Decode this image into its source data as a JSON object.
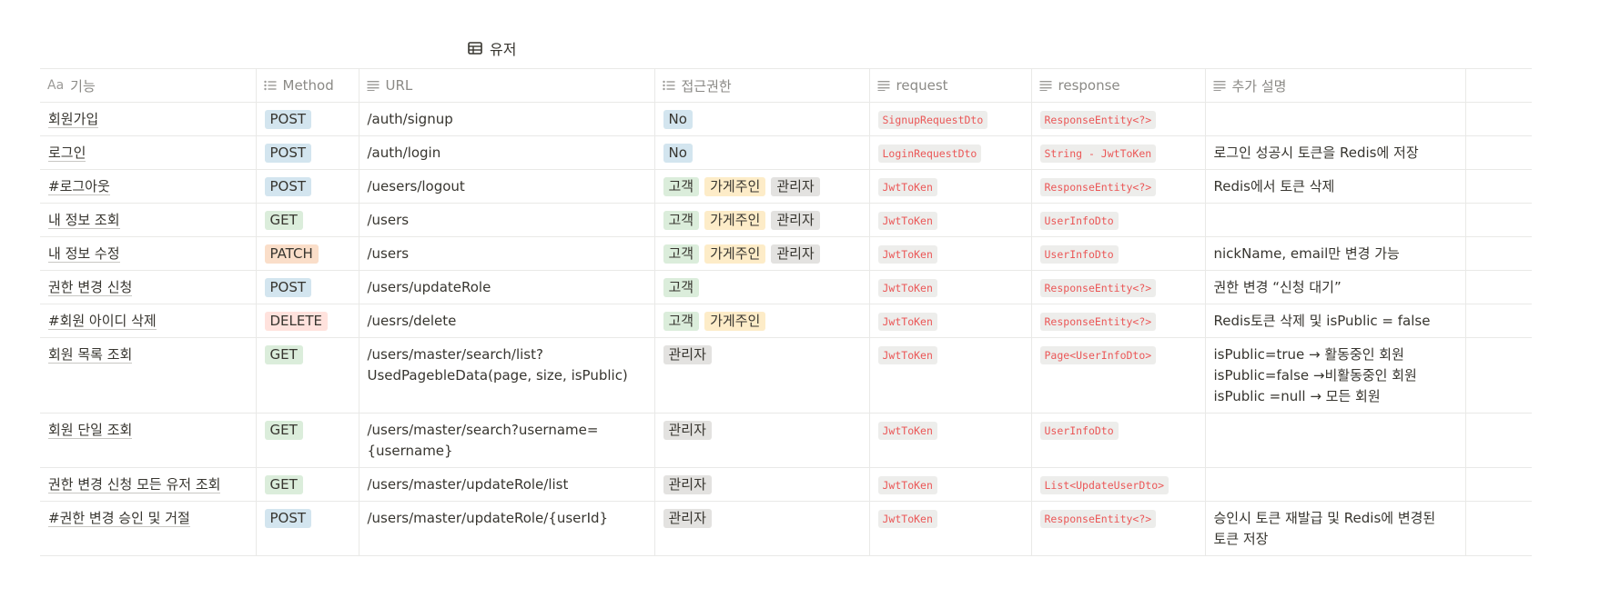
{
  "database": {
    "title": "유저"
  },
  "columns": [
    {
      "label": "기능",
      "icon": "text-title-icon"
    },
    {
      "label": "Method",
      "icon": "list-icon"
    },
    {
      "label": "URL",
      "icon": "text-lines-icon"
    },
    {
      "label": "접근권한",
      "icon": "list-icon"
    },
    {
      "label": "request",
      "icon": "text-lines-icon"
    },
    {
      "label": "response",
      "icon": "text-lines-icon"
    },
    {
      "label": "추가 설명",
      "icon": "text-lines-icon"
    }
  ],
  "title_col_prefix": "Aa",
  "rows": [
    {
      "name": "회원가입",
      "method": "POST",
      "url": [
        "/auth/signup"
      ],
      "access": [
        "No"
      ],
      "request": "SignupRequestDto",
      "response": "ResponseEntity<?>",
      "note": []
    },
    {
      "name": "로그인",
      "method": "POST",
      "url": [
        "/auth/login"
      ],
      "access": [
        "No"
      ],
      "request": "LoginRequestDto",
      "response": "String - JwtToKen",
      "note": [
        "로그인 성공시 토큰을 Redis에 저장"
      ]
    },
    {
      "name": "#로그아웃",
      "method": "POST",
      "url": [
        "/uesers/logout"
      ],
      "access": [
        "고객",
        "가게주인",
        "관리자"
      ],
      "request": "JwtToKen",
      "response": "ResponseEntity<?>",
      "note": [
        "Redis에서 토큰 삭제"
      ]
    },
    {
      "name": "내 정보 조회",
      "method": "GET",
      "url": [
        "/users"
      ],
      "access": [
        "고객",
        "가게주인",
        "관리자"
      ],
      "request": "JwtToKen",
      "response": "UserInfoDto",
      "note": []
    },
    {
      "name": "내 정보 수정",
      "method": "PATCH",
      "url": [
        "/users"
      ],
      "access": [
        "고객",
        "가게주인",
        "관리자"
      ],
      "request": "JwtToKen",
      "response": "UserInfoDto",
      "note": [
        "nickName, email만 변경 가능"
      ]
    },
    {
      "name": "권한 변경 신청",
      "method": "POST",
      "url": [
        "/users/updateRole"
      ],
      "access": [
        "고객"
      ],
      "request": "JwtToKen",
      "response": "ResponseEntity<?>",
      "note": [
        "권한 변경 “신청 대기”"
      ]
    },
    {
      "name": "#회원 아이디 삭제",
      "method": "DELETE",
      "url": [
        "/uesrs/delete"
      ],
      "access": [
        "고객",
        "가게주인"
      ],
      "request": "JwtToKen",
      "response": "ResponseEntity<?>",
      "note": [
        "Redis토큰 삭제 및  isPublic = false"
      ]
    },
    {
      "name": "회원 목록 조회",
      "method": "GET",
      "url": [
        "/users/master/search/list?",
        "UsedPagebleData(page, size, isPublic)"
      ],
      "access": [
        "관리자"
      ],
      "request": "JwtToKen",
      "response": "Page<UserInfoDto>",
      "note": [
        "isPublic=true → 활동중인 회원",
        "isPublic=false →비활동중인 회원",
        "isPublic =null → 모든 회원"
      ]
    },
    {
      "name": "회원 단일 조회",
      "method": "GET",
      "url": [
        "/users/master/search?username=",
        "{username}"
      ],
      "access": [
        "관리자"
      ],
      "request": "JwtToKen",
      "response": "UserInfoDto",
      "note": []
    },
    {
      "name": "권한 변경 신청 모든 유저 조회",
      "method": "GET",
      "url": [
        "/users/master/updateRole/list"
      ],
      "access": [
        "관리자"
      ],
      "request": "JwtToKen",
      "response": "List<UpdateUserDto>",
      "note": []
    },
    {
      "name": "#권한 변경 승인 및 거절",
      "method": "POST",
      "url": [
        "/users/master/updateRole/{userId}"
      ],
      "access": [
        "관리자"
      ],
      "request": "JwtToKen",
      "response": "ResponseEntity<?>",
      "note": [
        "승인시 토큰 재발급 및 Redis에 변경된",
        "토큰 저장"
      ]
    }
  ],
  "colors": {
    "method": {
      "POST": "#d3e5ef",
      "GET": "#dbeddb",
      "PATCH": "#fadec9",
      "DELETE": "#ffe2dd"
    },
    "access": {
      "No": "#d3e5ef",
      "고객": "#dbeddb",
      "가게주인": "#fdecc8",
      "관리자": "#e3e2e0"
    },
    "code_text": "#eb5757"
  }
}
